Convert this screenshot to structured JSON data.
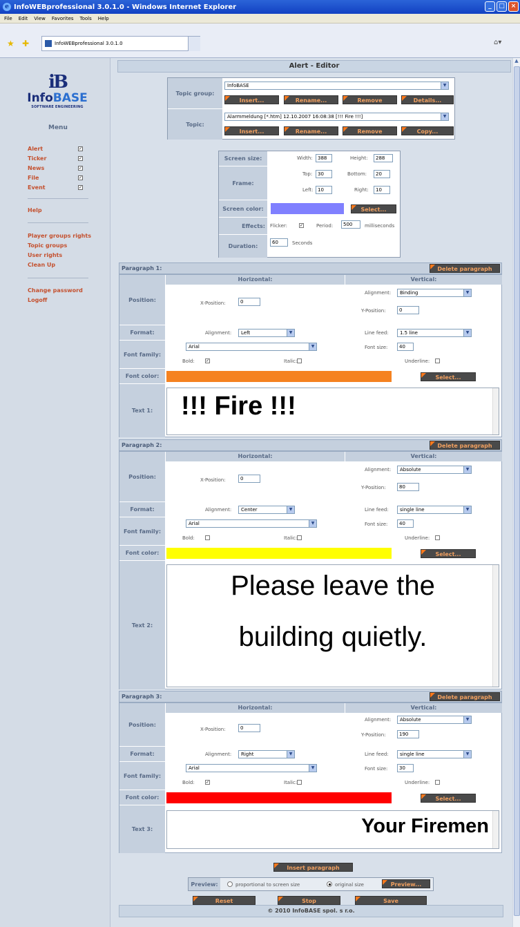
{
  "window": {
    "title": "InfoWEBprofessional 3.0.1.0 - Windows Internet Explorer",
    "tab_title": "InfoWEBprofessional 3.0.1.0"
  },
  "menubar": [
    "File",
    "Edit",
    "View",
    "Favorites",
    "Tools",
    "Help"
  ],
  "logo": {
    "mark": "iB",
    "name_a": "Info",
    "name_b": "BASE",
    "sub": "SOFTWARE ENGINEERING"
  },
  "sidebar": {
    "menu_title": "Menu",
    "alerts": [
      {
        "label": "Alert",
        "checked": true
      },
      {
        "label": "Ticker",
        "checked": true
      },
      {
        "label": "News",
        "checked": true
      },
      {
        "label": "File",
        "checked": true
      },
      {
        "label": "Event",
        "checked": true
      }
    ],
    "help": "Help",
    "admin": [
      "Player groups rights",
      "Topic groups",
      "User rights",
      "Clean Up"
    ],
    "account": [
      "Change password",
      "Logoff"
    ]
  },
  "header": "Alert - Editor",
  "topic": {
    "group_label": "Topic group:",
    "group_value": "InfoBASE",
    "topic_label": "Topic:",
    "topic_value": "Alarmmeldung [*.htm]   12.10.2007 16:08:38   [!!! Fire !!!]",
    "btn_insert": "Insert...",
    "btn_rename": "Rename...",
    "btn_remove": "Remove",
    "btn_details": "Details...",
    "btn_copy": "Copy..."
  },
  "screen": {
    "size_label": "Screen size:",
    "width_label": "Width:",
    "width": "388",
    "height_label": "Height:",
    "height": "288",
    "frame_label": "Frame:",
    "top_label": "Top:",
    "top": "30",
    "bottom_label": "Bottom:",
    "bottom": "20",
    "left_label": "Left:",
    "left": "10",
    "right_label": "Right:",
    "right": "10",
    "color_label": "Screen color:",
    "color": "#8080ff",
    "select": "Select...",
    "effects_label": "Effects:",
    "flicker_label": "Flicker:",
    "period_label": "Period:",
    "period": "500",
    "period_unit": "milliseconds",
    "duration_label": "Duration:",
    "duration": "60",
    "duration_unit": "Seconds"
  },
  "labels": {
    "delete": "Delete paragraph",
    "horizontal": "Horizontal:",
    "vertical": "Vertical:",
    "position": "Position:",
    "xpos": "X-Position:",
    "alignment": "Alignment:",
    "ypos": "Y-Position:",
    "format": "Format:",
    "linefeed": "Line feed:",
    "fontsize": "Font size:",
    "fontfamily": "Font family:",
    "bold": "Bold:",
    "italic": "Italic:",
    "underline": "Underline:",
    "fontcolor": "Font color:",
    "select": "Select..."
  },
  "paragraphs": [
    {
      "title": "Paragraph 1:",
      "xpos": "0",
      "valign": "Binding",
      "ypos": "0",
      "halign": "Left",
      "linefeed": "1.5 line",
      "fontsize": "40",
      "font": "Arial",
      "bold": true,
      "color": "#f58220",
      "text_label": "Text 1:",
      "text": "!!! Fire !!!"
    },
    {
      "title": "Paragraph 2:",
      "xpos": "0",
      "valign": "Absolute",
      "ypos": "80",
      "halign": "Center",
      "linefeed": "single line",
      "fontsize": "40",
      "font": "Arial",
      "bold": false,
      "color": "#ffff00",
      "text_label": "Text 2:",
      "text_line1": "Please leave the",
      "text_line2": "building quietly."
    },
    {
      "title": "Paragraph 3:",
      "xpos": "0",
      "valign": "Absolute",
      "ypos": "190",
      "halign": "Right",
      "linefeed": "single line",
      "fontsize": "30",
      "font": "Arial",
      "bold": true,
      "color": "#ff0000",
      "text_label": "Text 3:",
      "text": "Your Firemen"
    }
  ],
  "insert_paragraph": "Insert paragraph",
  "preview": {
    "label": "Preview:",
    "opt1": "proportional to screen size",
    "opt2": "original size",
    "btn": "Preview..."
  },
  "actions": {
    "reset": "Reset",
    "stop": "Stop",
    "save": "Save"
  },
  "footer": "© 2010 InfoBASE spol. s r.o."
}
